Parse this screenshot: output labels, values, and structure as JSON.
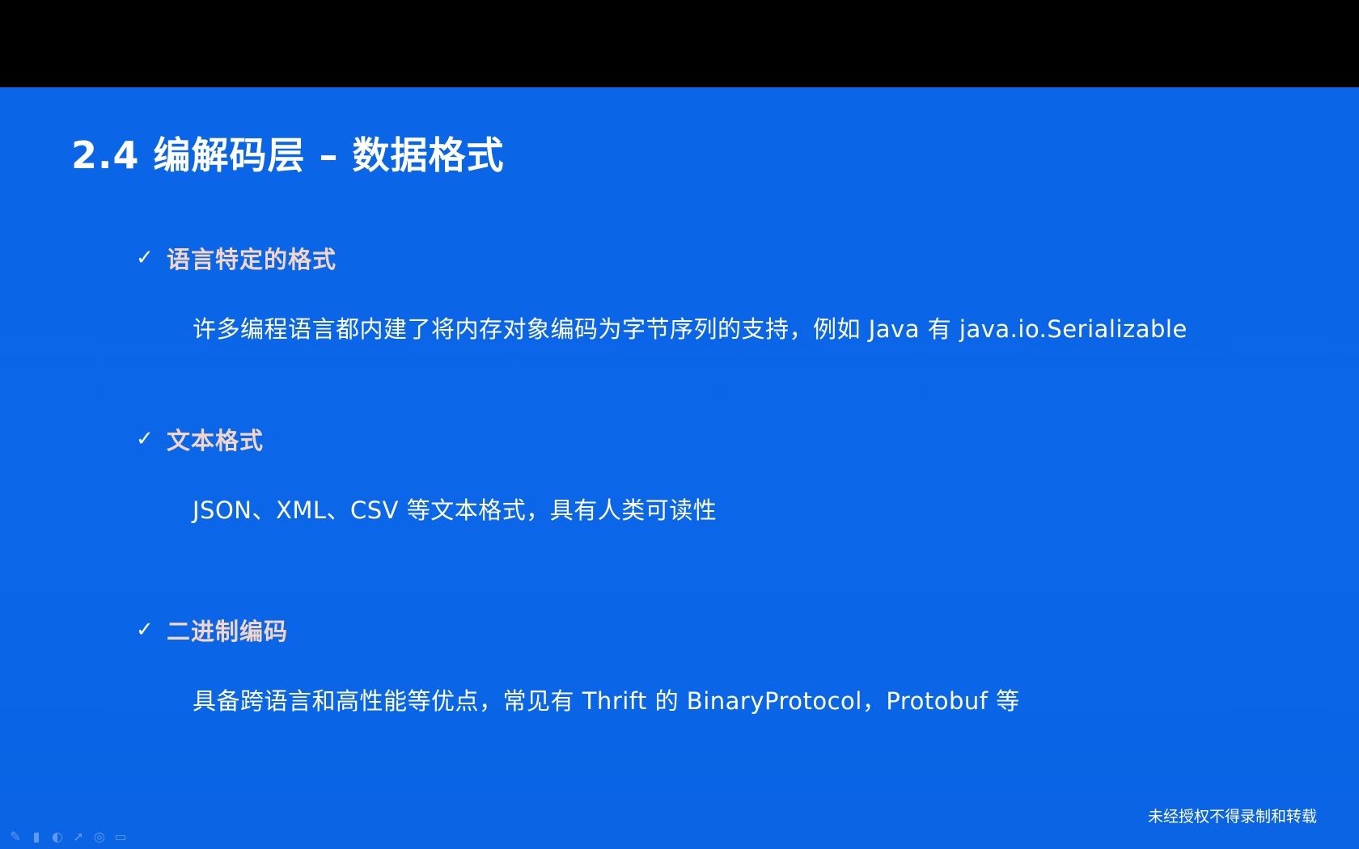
{
  "slide": {
    "title": "2.4 编解码层 – 数据格式",
    "sections": [
      {
        "heading": "语言特定的格式",
        "body": "许多编程语言都内建了将内存对象编码为字节序列的支持，例如 Java 有 java.io.Serializable"
      },
      {
        "heading": "文本格式",
        "body": "JSON、XML、CSV 等文本格式，具有人类可读性"
      },
      {
        "heading": "二进制编码",
        "body": "具备跨语言和高性能等优点，常见有 Thrift 的 BinaryProtocol，Protobuf 等"
      }
    ],
    "watermark": "未经授权不得录制和转载"
  },
  "icons": {
    "check": "✓",
    "controls": [
      "pen-icon",
      "highlighter-icon",
      "eraser-icon",
      "pointer-icon",
      "laser-icon",
      "screen-icon"
    ]
  },
  "colors": {
    "background": "#0a66e6",
    "heading": "#f3d6c8",
    "text": "#ffffff"
  }
}
